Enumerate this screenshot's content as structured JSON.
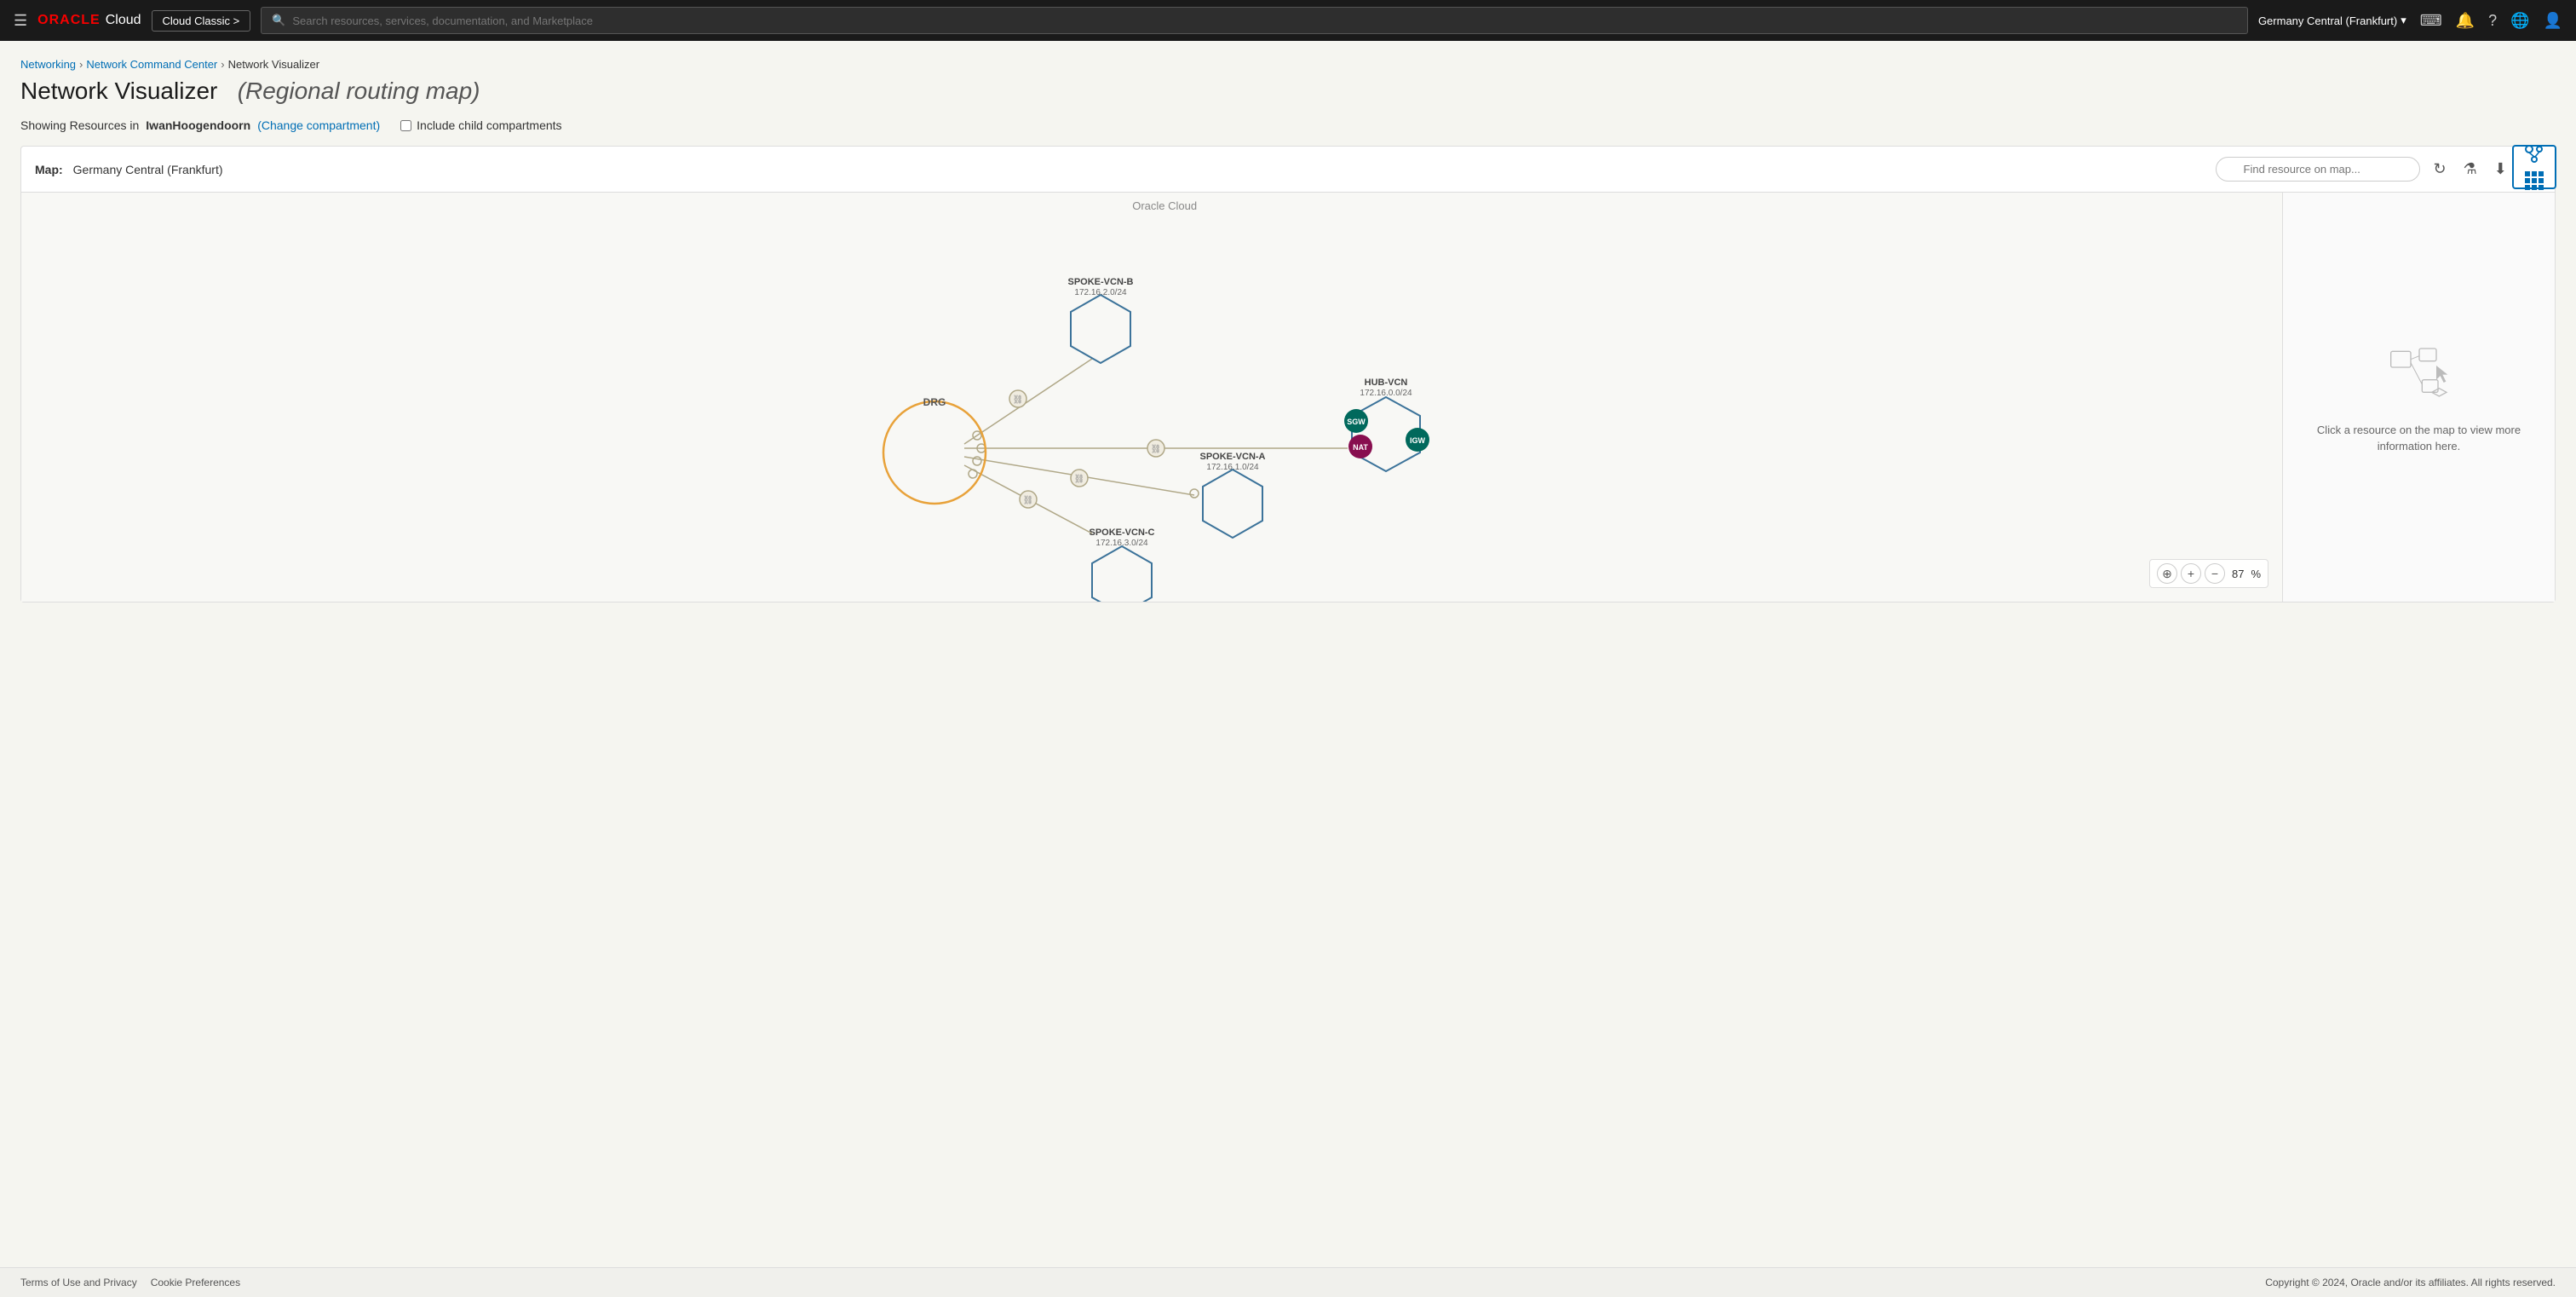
{
  "nav": {
    "oracle_text": "ORACLE",
    "cloud_text": "Cloud",
    "cloud_classic_label": "Cloud Classic >",
    "search_placeholder": "Search resources, services, documentation, and Marketplace",
    "region": "Germany Central (Frankfurt)",
    "hamburger_icon": "☰"
  },
  "breadcrumb": {
    "networking": "Networking",
    "network_command_center": "Network Command Center",
    "current": "Network Visualizer"
  },
  "page": {
    "title": "Network Visualizer",
    "subtitle": "(Regional routing map)",
    "compartment_label": "Showing Resources in",
    "compartment_name": "IwanHoogendoorn",
    "change_compartment": "(Change compartment)",
    "include_child": "Include child compartments"
  },
  "toolbar": {
    "map_label": "Map:",
    "map_region": "Germany Central (Frankfurt)",
    "find_placeholder": "Find resource on map..."
  },
  "map": {
    "oracle_cloud_label": "Oracle Cloud",
    "zoom_value": "87",
    "zoom_unit": "%"
  },
  "nodes": {
    "spoke_vcn_b": {
      "label": "SPOKE-VCN-B",
      "cidr": "172.16.2.0/24"
    },
    "hub_vcn": {
      "label": "HUB-VCN",
      "cidr": "172.16.0.0/24"
    },
    "spoke_vcn_a": {
      "label": "SPOKE-VCN-A",
      "cidr": "172.16.1.0/24"
    },
    "spoke_vcn_c": {
      "label": "SPOKE-VCN-C",
      "cidr": "172.16.3.0/24"
    },
    "drg": {
      "label": "DRG"
    },
    "sgw": {
      "label": "SGW"
    },
    "igw": {
      "label": "IGW"
    },
    "nat": {
      "label": "NAT"
    }
  },
  "side_panel": {
    "message": "Click a resource on the map to view more information here."
  },
  "footer": {
    "terms": "Terms of Use and Privacy",
    "cookie": "Cookie Preferences",
    "copyright": "Copyright © 2024, Oracle and/or its affiliates. All rights reserved."
  }
}
